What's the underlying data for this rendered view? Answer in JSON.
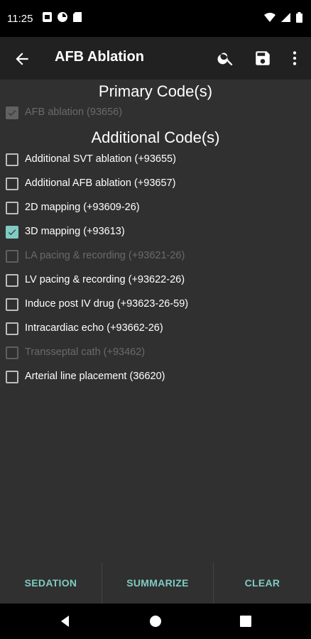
{
  "status_bar": {
    "time": "11:25"
  },
  "app_bar": {
    "title": "AFB Ablation"
  },
  "primary": {
    "heading": "Primary Code(s)",
    "items": [
      {
        "label": "AFB ablation (93656)",
        "checked": true,
        "disabled": true
      }
    ]
  },
  "additional": {
    "heading": "Additional Code(s)",
    "items": [
      {
        "label": "Additional SVT ablation (+93655)",
        "checked": false,
        "disabled": false
      },
      {
        "label": "Additional AFB ablation (+93657)",
        "checked": false,
        "disabled": false
      },
      {
        "label": "2D mapping (+93609-26)",
        "checked": false,
        "disabled": false
      },
      {
        "label": "3D mapping (+93613)",
        "checked": true,
        "disabled": false
      },
      {
        "label": "LA pacing & recording (+93621-26)",
        "checked": false,
        "disabled": true
      },
      {
        "label": "LV pacing & recording (+93622-26)",
        "checked": false,
        "disabled": false
      },
      {
        "label": "Induce post IV drug (+93623-26-59)",
        "checked": false,
        "disabled": false
      },
      {
        "label": "Intracardiac echo (+93662-26)",
        "checked": false,
        "disabled": false
      },
      {
        "label": "Transseptal cath (+93462)",
        "checked": false,
        "disabled": true
      },
      {
        "label": "Arterial line placement (36620)",
        "checked": false,
        "disabled": false
      }
    ]
  },
  "bottom_bar": {
    "sedation": "SEDATION",
    "summarize": "SUMMARIZE",
    "clear": "CLEAR"
  },
  "colors": {
    "accent": "#80cbc4",
    "background": "#303030",
    "app_bar": "#212121"
  }
}
